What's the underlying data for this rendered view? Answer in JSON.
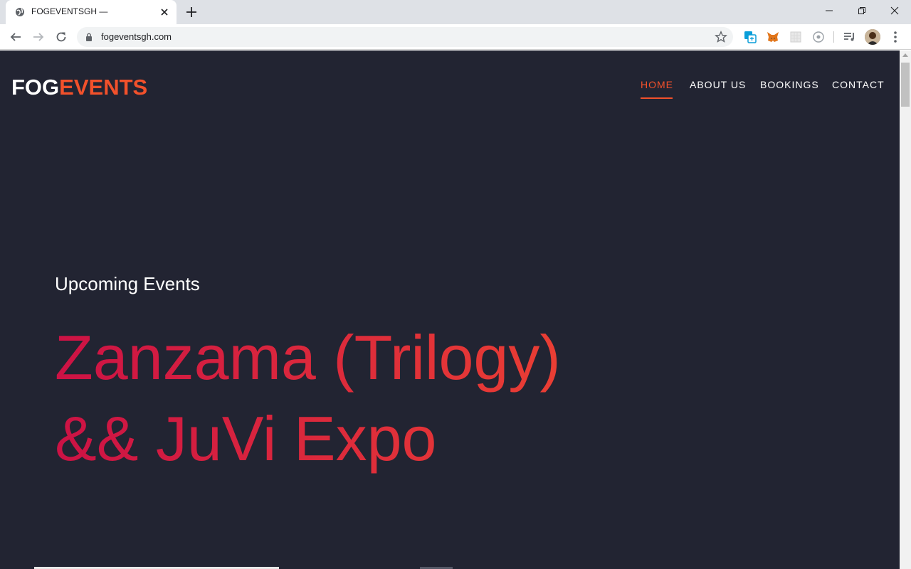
{
  "browser": {
    "tab_title": "FOGEVENTSGH —",
    "url": "fogeventsgh.com",
    "icons": {
      "favicon": "globe-icon",
      "close": "close-icon",
      "new_tab": "plus-icon",
      "back": "back-arrow-icon",
      "forward": "forward-arrow-icon",
      "reload": "reload-icon",
      "lock": "lock-icon",
      "bookmark": "star-icon",
      "menu": "kebab-menu-icon"
    },
    "extensions": [
      "translate-extension-icon",
      "metamask-fox-icon",
      "grid-extension-icon",
      "eye-extension-icon",
      "media-queue-icon"
    ]
  },
  "site": {
    "logo": {
      "part1": "FOG",
      "part2": "EVENTS"
    },
    "nav": [
      {
        "label": "HOME",
        "active": true
      },
      {
        "label": "ABOUT US",
        "active": false
      },
      {
        "label": "BOOKINGS",
        "active": false
      },
      {
        "label": "CONTACT",
        "active": false
      }
    ],
    "hero": {
      "subtitle": "Upcoming Events",
      "title_line1": "Zanzama (Trilogy)",
      "title_line2": "&& JuVi Expo"
    }
  },
  "colors": {
    "background": "#222432",
    "accent": "#f2512b",
    "gradient_start": "#cc1245",
    "gradient_end": "#f24a2f"
  }
}
